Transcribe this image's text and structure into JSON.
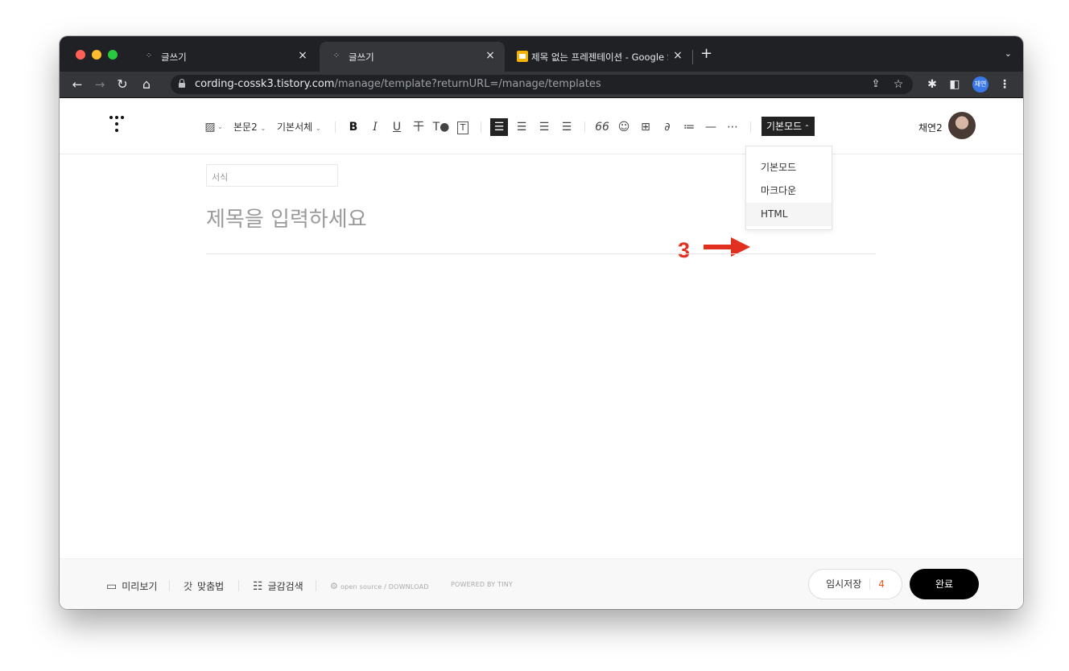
{
  "tabs": [
    {
      "title": "글쓰기",
      "active": false
    },
    {
      "title": "글쓰기",
      "active": true
    },
    {
      "title": "제목 없는 프레젠테이션 - Google S",
      "active": false
    }
  ],
  "address": {
    "host": "cording-cossk3.tistory.com",
    "path": "/manage/template?returnURL=/manage/templates"
  },
  "profile_badge": "채연",
  "toolbar": {
    "paragraph_style": "본문2",
    "font": "기본서체",
    "bold": "B",
    "italic": "I",
    "underline": "U",
    "strike": "干",
    "text_color": "T●",
    "text_bg": "T",
    "quote": "66",
    "mode_button": "기본모드"
  },
  "user_name": "채연2",
  "mode_dropdown": {
    "items": [
      "기본모드",
      "마크다운",
      "HTML"
    ],
    "highlighted": "HTML"
  },
  "editor": {
    "format_placeholder": "서식",
    "title_placeholder": "제목을 입력하세요"
  },
  "footer": {
    "preview": "미리보기",
    "spellcheck": "맞춤법",
    "search": "글감검색",
    "open_source": "open source / DOWNLOAD",
    "powered_by": "POWERED BY TINY",
    "temp_save": "임시저장",
    "temp_save_count": "4",
    "done": "완료"
  },
  "annotation": {
    "number": "3",
    "color": "#e1301f"
  }
}
